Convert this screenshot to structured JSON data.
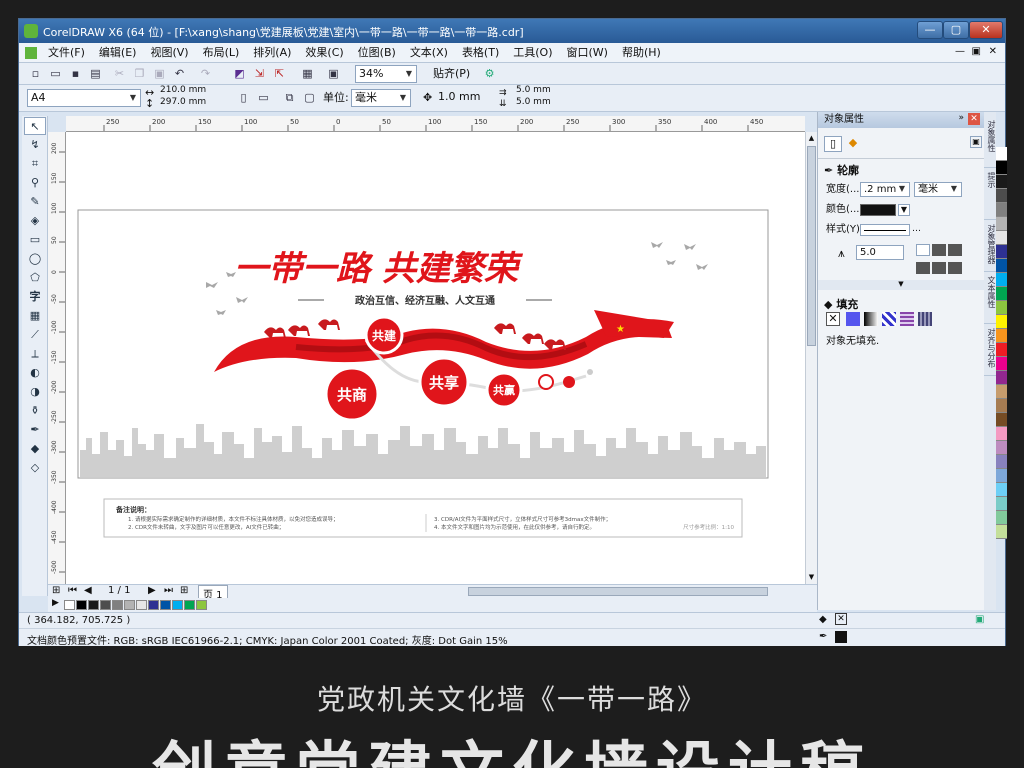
{
  "window": {
    "title": "CorelDRAW X6 (64 位) - [F:\\xang\\shang\\党建展板\\党建\\室内\\一带一路\\一带一路\\一带一路.cdr]",
    "minimize": "—",
    "maximize": "▢",
    "close": "✕",
    "doc_minimize": "—",
    "doc_restore": "▣",
    "doc_close": "✕"
  },
  "menu": [
    "文件(F)",
    "编辑(E)",
    "视图(V)",
    "布局(L)",
    "排列(A)",
    "效果(C)",
    "位图(B)",
    "文本(X)",
    "表格(T)",
    "工具(O)",
    "窗口(W)",
    "帮助(H)"
  ],
  "toolbar": {
    "zoom": "34%",
    "snap": "贴齐(P)"
  },
  "propertybar": {
    "page_size": "A4",
    "width": "210.0 mm",
    "height": "297.0 mm",
    "units_label": "单位:",
    "units": "毫米",
    "nudge": "1.0 mm",
    "dup_x": "5.0 mm",
    "dup_y": "5.0 mm"
  },
  "ruler": {
    "h_ticks": [
      "250",
      "200",
      "150",
      "100",
      "50",
      "0",
      "50",
      "100",
      "150",
      "200",
      "250",
      "300",
      "350",
      "400",
      "450"
    ],
    "v_ticks": [
      "200",
      "150",
      "100",
      "50",
      "0",
      "-50",
      "-100",
      "-150",
      "-200",
      "-250",
      "-300",
      "-350",
      "-400",
      "-450",
      "-500"
    ]
  },
  "design": {
    "title": "一带一路 共建繁荣",
    "subtitle": "政治互信、经济互融、人文互通",
    "circles": [
      "共建",
      "共商",
      "共享",
      "共赢"
    ],
    "notes_heading": "备注说明：",
    "notes": [
      "1. 请根据实际需求确定制作的详细材质，本文件不标注具体材质，以免对您造成误导；",
      "2. CDR文件未转曲，文字及图片可以任意更改，AI文件已转曲；",
      "3. CDR/AI文件为平面样式尺寸，立体样式尺寸可参考3dmax文件制作；",
      "4. 本文件文字和图片均为示范使用，在此仅供参考，请自行酌定。"
    ],
    "scale_note": "尺寸参考比例：1:10"
  },
  "pagebar": {
    "page_counter": "1 / 1",
    "page_tab": "页 1"
  },
  "status": {
    "coords": "( 364.182, 705.725 )",
    "color_profile": "文档颜色预置文件: RGB: sRGB IEC61966-2.1; CMYK: Japan Color 2001 Coated; 灰度: Dot Gain 15%"
  },
  "docker": {
    "title": "对象属性",
    "outline_heading": "轮廓",
    "width_label": "宽度(...",
    "width_value": ".2 mm",
    "width_unit": "毫米",
    "color_label": "颜色(...",
    "style_label": "样式(Y):",
    "miter_value": "5.0",
    "fill_heading": "填充",
    "fill_status": "对象无填充.",
    "side_tabs": [
      "对象属性",
      "提示",
      "对象管理器",
      "文本属性",
      "对齐与分布"
    ]
  },
  "palette_colors": [
    "#ffffff",
    "#000000",
    "#1a1a1a",
    "#4d4d4d",
    "#808080",
    "#b3b3b3",
    "#e6e6e6",
    "#2e3192",
    "#0054a6",
    "#00aeef",
    "#00a651",
    "#8dc63f",
    "#fff200",
    "#f7941d",
    "#ed1c24",
    "#ec008c",
    "#92278f",
    "#c69c6d",
    "#a67c52",
    "#754c24",
    "#f49ac2",
    "#bd8cbf",
    "#8882be",
    "#7da7d9",
    "#6dcff6",
    "#7accc8",
    "#82ca9c",
    "#c4df9b"
  ],
  "captions": {
    "line1": "党政机关文化墙《一带一路》",
    "line2": "创意党建文化墙设计稿"
  }
}
